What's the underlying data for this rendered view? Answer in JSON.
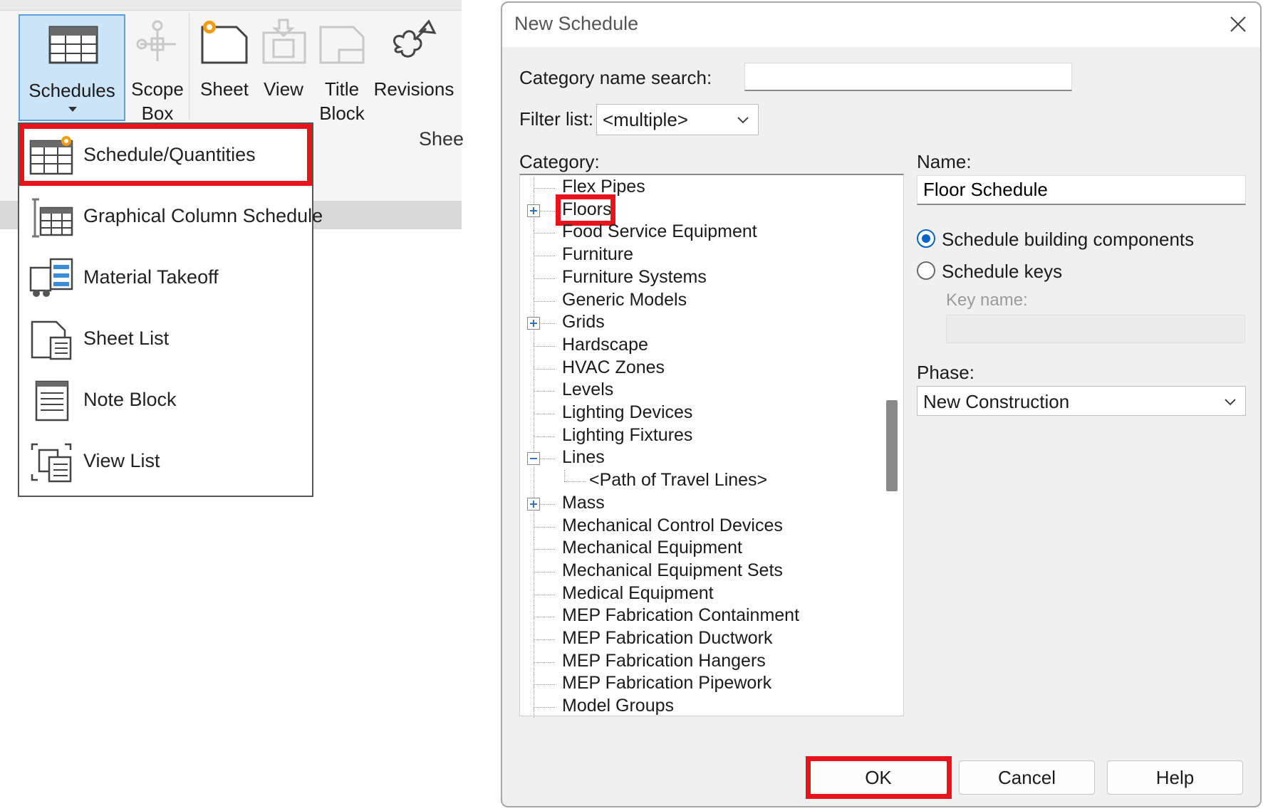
{
  "ribbon": {
    "buttons": [
      {
        "label": "Schedules",
        "state": "active"
      },
      {
        "label": "Scope\nBox",
        "state": "disabled"
      },
      {
        "label": "Sheet",
        "state": "enabled"
      },
      {
        "label": "View",
        "state": "disabled"
      },
      {
        "label": "Title\nBlock",
        "state": "disabled"
      },
      {
        "label": "Revisions",
        "state": "enabled"
      }
    ],
    "panel_label": "Shee"
  },
  "menu": {
    "items": [
      {
        "label": "Schedule/Quantities",
        "icon": "schedule-quantities-icon"
      },
      {
        "label": "Graphical Column Schedule",
        "icon": "graphical-column-schedule-icon"
      },
      {
        "label": "Material Takeoff",
        "icon": "material-takeoff-icon"
      },
      {
        "label": "Sheet List",
        "icon": "sheet-list-icon"
      },
      {
        "label": "Note Block",
        "icon": "note-block-icon"
      },
      {
        "label": "View List",
        "icon": "view-list-icon"
      }
    ]
  },
  "dialog": {
    "title": "New Schedule",
    "category_search_label": "Category name search:",
    "category_search_value": "",
    "filter_label": "Filter list:",
    "filter_value": "<multiple>",
    "category_label": "Category:",
    "categories": [
      {
        "label": "Flex Pipes",
        "expander": "none",
        "level": 0
      },
      {
        "label": "Floors",
        "expander": "plus",
        "level": 0,
        "selected": true
      },
      {
        "label": "Food Service Equipment",
        "expander": "none",
        "level": 0
      },
      {
        "label": "Furniture",
        "expander": "none",
        "level": 0
      },
      {
        "label": "Furniture Systems",
        "expander": "none",
        "level": 0
      },
      {
        "label": "Generic Models",
        "expander": "none",
        "level": 0
      },
      {
        "label": "Grids",
        "expander": "plus",
        "level": 0
      },
      {
        "label": "Hardscape",
        "expander": "none",
        "level": 0
      },
      {
        "label": "HVAC Zones",
        "expander": "none",
        "level": 0
      },
      {
        "label": "Levels",
        "expander": "none",
        "level": 0
      },
      {
        "label": "Lighting Devices",
        "expander": "none",
        "level": 0
      },
      {
        "label": "Lighting Fixtures",
        "expander": "none",
        "level": 0
      },
      {
        "label": "Lines",
        "expander": "minus",
        "level": 0
      },
      {
        "label": "<Path of Travel Lines>",
        "expander": "none",
        "level": 1
      },
      {
        "label": "Mass",
        "expander": "plus",
        "level": 0
      },
      {
        "label": "Mechanical Control Devices",
        "expander": "none",
        "level": 0
      },
      {
        "label": "Mechanical Equipment",
        "expander": "none",
        "level": 0
      },
      {
        "label": "Mechanical Equipment Sets",
        "expander": "none",
        "level": 0
      },
      {
        "label": "Medical Equipment",
        "expander": "none",
        "level": 0
      },
      {
        "label": "MEP Fabrication Containment",
        "expander": "none",
        "level": 0
      },
      {
        "label": "MEP Fabrication Ductwork",
        "expander": "none",
        "level": 0
      },
      {
        "label": "MEP Fabrication Hangers",
        "expander": "none",
        "level": 0
      },
      {
        "label": "MEP Fabrication Pipework",
        "expander": "none",
        "level": 0
      },
      {
        "label": "Model Groups",
        "expander": "none",
        "level": 0
      }
    ],
    "name_label": "Name:",
    "name_value": "Floor Schedule",
    "radio_building": "Schedule building components",
    "radio_keys": "Schedule keys",
    "radio_selected": "building",
    "key_name_label": "Key name:",
    "key_name_value": "",
    "phase_label": "Phase:",
    "phase_value": "New Construction",
    "buttons": {
      "ok": "OK",
      "cancel": "Cancel",
      "help": "Help"
    }
  },
  "colors": {
    "highlight": "#e8141c",
    "accent": "#0a64c8",
    "ribbon_active": "#cce4f7"
  }
}
